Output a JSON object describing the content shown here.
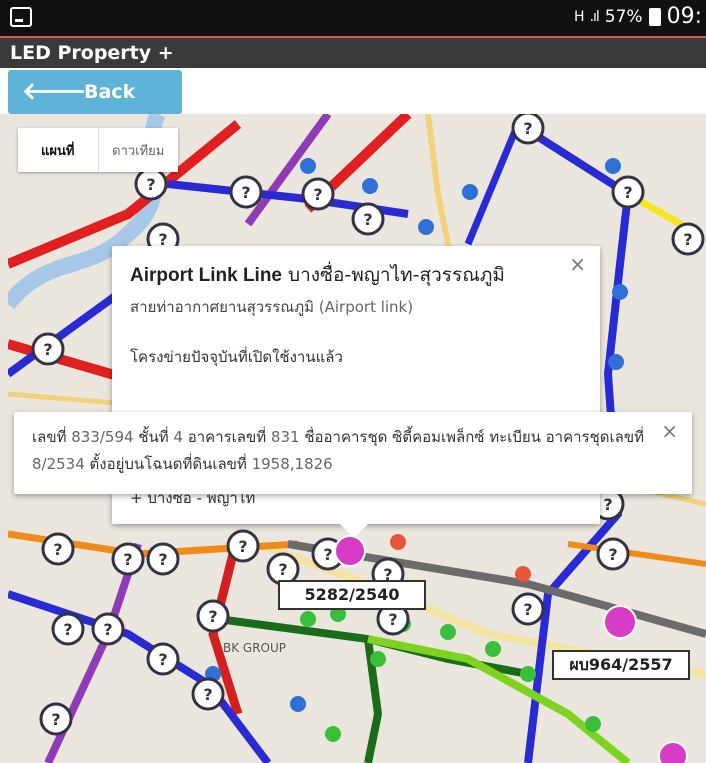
{
  "status": {
    "network": "H",
    "battery_percent": "57%",
    "time": "09:"
  },
  "app": {
    "title": "LED Property +"
  },
  "nav": {
    "back_label": "Back"
  },
  "map": {
    "type_control": {
      "map_label": "แผนที่",
      "satellite_label": "ดาวเทียม"
    },
    "map_labels": [
      "BK GROUP"
    ],
    "info_line": {
      "title_bold": "Airport Link Line",
      "title_rest": " บางซื่อ-พญาไท-สุวรรณภูมิ",
      "subtitle_th": "สายท่าอากาศยานสุวรรณภูมิ",
      "subtitle_en": " (Airport link)",
      "network_label": "โครงข่ายปัจจุบันที่เปิดใช้งานแล้ว",
      "route_bottom": "+ บางซื่อ - พญาไท",
      "close": "×"
    },
    "info_property": {
      "prefix": "เลขที่ ",
      "number": "833/594",
      "text1": " ชั้นที่ ",
      "floor": "4",
      "text2": " อาคารเลขที่ ",
      "building": "831",
      "text3": " ชื่ออาคารชุด ซิตี้คอมเพล็กซ์ ทะเบียน อาคารชุดเลขที่ ",
      "reg": "8/2534",
      "text4": " ตั้งอยู่บนโฉนดที่ดินเลขที่ ",
      "deeds": "1958,1826",
      "close": "×"
    },
    "plates": [
      "5282/2540",
      "ผบ964/2557"
    ]
  }
}
